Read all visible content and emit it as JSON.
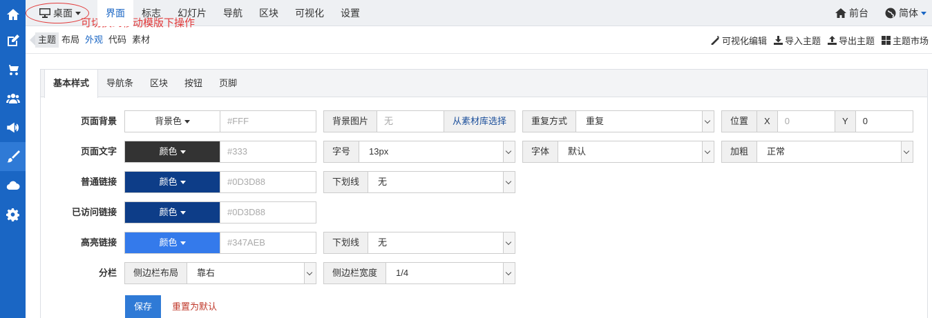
{
  "colors": {
    "primary": "#1a66c4",
    "hint": "#e23a3a",
    "reset": "#c0392b"
  },
  "sidebar_icons": [
    "home-icon",
    "edit-icon",
    "cart-icon",
    "users-icon",
    "megaphone-icon",
    "brush-icon",
    "cloud-icon",
    "gear-icon"
  ],
  "topnav": {
    "device_label": "桌面",
    "hint": "可切换到移动模版下操作",
    "items": [
      "界面",
      "标志",
      "幻灯片",
      "导航",
      "区块",
      "可视化",
      "设置"
    ],
    "frontend": "前台",
    "lang": "简体"
  },
  "subnav": {
    "items": [
      "主题",
      "布局",
      "外观",
      "代码",
      "素材"
    ],
    "visual_edit": "可视化编辑",
    "import": "导入主题",
    "export": "导出主题",
    "market": "主题市场"
  },
  "tabs": [
    "基本样式",
    "导航条",
    "区块",
    "按钮",
    "页脚"
  ],
  "form": {
    "page_bg": {
      "label": "页面背景",
      "btn": "背景色",
      "value": "#FFF",
      "img_label": "背景图片",
      "img_value": "无",
      "img_link": "从素材库选择",
      "repeat_label": "重复方式",
      "repeat_value": "重复",
      "pos_label": "位置",
      "x_label": "X",
      "x_value": "0",
      "y_label": "Y",
      "y_value": "0"
    },
    "page_text": {
      "label": "页面文字",
      "btn": "颜色",
      "value": "#333",
      "color": "#333333",
      "size_label": "字号",
      "size_value": "13px",
      "font_label": "字体",
      "font_value": "默认",
      "bold_label": "加粗",
      "bold_value": "正常"
    },
    "link": {
      "label": "普通链接",
      "btn": "颜色",
      "value": "#0D3D88",
      "color": "#0D3D88",
      "underline_label": "下划线",
      "underline_value": "无"
    },
    "visited": {
      "label": "已访问链接",
      "btn": "颜色",
      "value": "#0D3D88",
      "color": "#0D3D88"
    },
    "hover": {
      "label": "高亮链接",
      "btn": "颜色",
      "value": "#347AEB",
      "color": "#347AEB",
      "underline_label": "下划线",
      "underline_value": "无"
    },
    "column": {
      "label": "分栏",
      "layout_label": "侧边栏布局",
      "layout_value": "靠右",
      "width_label": "侧边栏宽度",
      "width_value": "1/4"
    },
    "save": "保存",
    "reset": "重置为默认"
  }
}
